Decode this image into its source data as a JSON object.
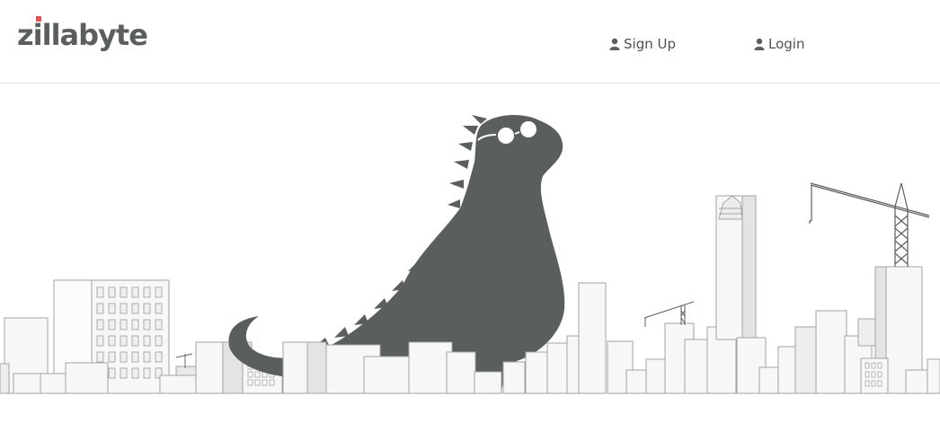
{
  "brand": {
    "logo_text": "zillabyte",
    "accent_color": "#e2534b",
    "text_color": "#5a5f5d"
  },
  "nav": {
    "signup": {
      "label": "Sign Up",
      "icon": "user-icon"
    },
    "login": {
      "label": "Login",
      "icon": "user-icon"
    }
  },
  "hero": {
    "mascot_color": "#5a5f5d",
    "building_stroke": "#9a9a9a",
    "building_fill": "#f6f6f6"
  }
}
